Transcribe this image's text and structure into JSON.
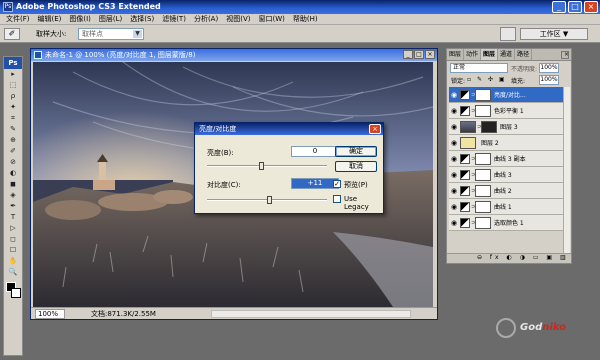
{
  "titlebar": {
    "title": "Adobe Photoshop CS3 Extended"
  },
  "menu": [
    "文件(F)",
    "编辑(E)",
    "图像(I)",
    "图层(L)",
    "选择(S)",
    "滤镜(T)",
    "分析(A)",
    "视图(V)",
    "窗口(W)",
    "帮助(H)"
  ],
  "options": {
    "label": "取样大小:",
    "select_value": "取样点",
    "workspace": "工作区 ▼"
  },
  "toolbox": {
    "logo": "Ps",
    "tools": [
      "▸",
      "⬚",
      "ρ",
      "✦",
      "⌗",
      "✎",
      "⊕",
      "✐",
      "⊘",
      "◐",
      "◼",
      "◈",
      "✒",
      "T",
      "▷",
      "◻",
      "☐",
      "✋",
      "🔍"
    ]
  },
  "document": {
    "title": "未命名-1 @ 100% (亮度/对比度 1, 图层蒙版/8)",
    "zoom": "100%",
    "info": "文档:871.3K/2.55M"
  },
  "dialog": {
    "title": "亮度/对比度",
    "brightness_label": "亮度(B):",
    "brightness_value": "0",
    "contrast_label": "对比度(C):",
    "contrast_value": "+11",
    "ok": "确定",
    "cancel": "取消",
    "preview": "预览(P)",
    "preview_checked": true,
    "legacy": "Use Legacy",
    "legacy_checked": false
  },
  "panel": {
    "tabs": [
      "图层",
      "动作",
      "图层",
      "通道",
      "路径"
    ],
    "active_tab": 2,
    "blend": "正常",
    "opacity_label": "不透明度:",
    "opacity": "100%",
    "lock_label": "锁定:",
    "fill_label": "填充:",
    "fill": "100%",
    "layers": [
      {
        "name": "亮度/对比...",
        "type": "adjust",
        "selected": true
      },
      {
        "name": "色彩平衡 1",
        "type": "adjust",
        "selected": false
      },
      {
        "name": "图层 3",
        "type": "image",
        "selected": false
      },
      {
        "name": "图层 2",
        "type": "yellow",
        "selected": false
      },
      {
        "name": "曲线 3 副本",
        "type": "adjust",
        "selected": false
      },
      {
        "name": "曲线 3",
        "type": "adjust",
        "selected": false
      },
      {
        "name": "曲线 2",
        "type": "adjust",
        "selected": false
      },
      {
        "name": "曲线 1",
        "type": "adjust",
        "selected": false
      },
      {
        "name": "选取颜色 1",
        "type": "adjust",
        "selected": false
      }
    ]
  },
  "watermark": {
    "a": "God",
    "b": "niko"
  }
}
